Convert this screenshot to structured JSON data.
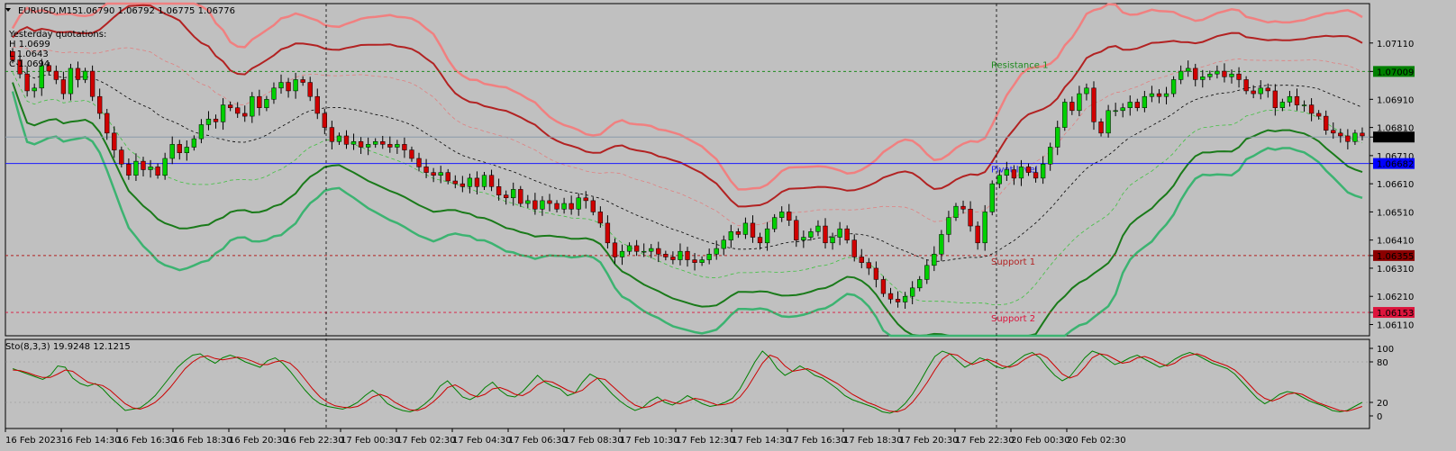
{
  "chart_data": [
    {
      "type": "candlestick",
      "symbol_header": "EURUSD,M15",
      "ohlc_header": "1.06790 1.06792 1.06775 1.06776",
      "yesterday": {
        "title": "Yesterday quotations:",
        "h": "H 1.0699",
        "l": "L 1.0643",
        "c": "C 1.0694"
      },
      "ylim": [
        1.0607,
        1.0725
      ],
      "y_ticks": [
        "1.07110",
        "1.07009",
        "1.06910",
        "1.06810",
        "1.06776",
        "1.06710",
        "1.06682",
        "1.06610",
        "1.06510",
        "1.06410",
        "1.06355",
        "1.06310",
        "1.06210",
        "1.06153",
        "1.06110"
      ],
      "highlighted_ticks": [
        {
          "value": "1.07009",
          "bg": "#008000"
        },
        {
          "value": "1.06776",
          "bg": "#000000"
        },
        {
          "value": "1.06682",
          "bg": "#0000ff"
        },
        {
          "value": "1.06355",
          "bg": "#8b0000"
        },
        {
          "value": "1.06153",
          "bg": "#dc143c"
        }
      ],
      "levels": [
        {
          "label": "Resistance 1",
          "value": 1.07009,
          "color": "#1e8a1e",
          "style": "dotted"
        },
        {
          "label": "Pivot level",
          "value": 1.06682,
          "color": "#1a1aff",
          "style": "solid"
        },
        {
          "label": "Support 1",
          "value": 1.06355,
          "color": "#b22222",
          "style": "dotted"
        },
        {
          "label": "Support 2",
          "value": 1.06153,
          "color": "#dc143c",
          "style": "dotted"
        },
        {
          "label": "",
          "value": 1.06776,
          "color": "#8a9aaa",
          "style": "solid"
        }
      ],
      "close": [
        1.0705,
        1.07,
        1.0694,
        1.0695,
        1.0703,
        1.0701,
        1.0698,
        1.0693,
        1.0702,
        1.0698,
        1.0701,
        1.0692,
        1.0686,
        1.0679,
        1.0673,
        1.0668,
        1.0664,
        1.0669,
        1.0666,
        1.0667,
        1.0664,
        1.067,
        1.0675,
        1.0672,
        1.0674,
        1.0677,
        1.0682,
        1.0684,
        1.0683,
        1.0689,
        1.0688,
        1.0686,
        1.0685,
        1.0692,
        1.0688,
        1.0691,
        1.0695,
        1.0697,
        1.0694,
        1.0698,
        1.0697,
        1.0692,
        1.0686,
        1.0681,
        1.0676,
        1.0678,
        1.0675,
        1.0676,
        1.0674,
        1.0675,
        1.0676,
        1.0675,
        1.0674,
        1.0675,
        1.0673,
        1.067,
        1.0667,
        1.0665,
        1.0664,
        1.0665,
        1.0662,
        1.0661,
        1.066,
        1.0663,
        1.066,
        1.0664,
        1.066,
        1.0657,
        1.0656,
        1.0659,
        1.0654,
        1.0655,
        1.0652,
        1.0655,
        1.0654,
        1.0652,
        1.0654,
        1.0652,
        1.0656,
        1.0655,
        1.0651,
        1.0647,
        1.064,
        1.0635,
        1.0637,
        1.0639,
        1.0637,
        1.0637,
        1.0638,
        1.0636,
        1.0635,
        1.0634,
        1.0637,
        1.0634,
        1.0633,
        1.0634,
        1.0636,
        1.0638,
        1.0641,
        1.0644,
        1.0643,
        1.0647,
        1.0642,
        1.064,
        1.0645,
        1.0649,
        1.0651,
        1.0648,
        1.0641,
        1.0642,
        1.0644,
        1.0646,
        1.064,
        1.0642,
        1.0645,
        1.0641,
        1.0635,
        1.0633,
        1.0631,
        1.0627,
        1.0622,
        1.062,
        1.0619,
        1.0621,
        1.0624,
        1.0627,
        1.0632,
        1.0636,
        1.0643,
        1.0649,
        1.0653,
        1.0652,
        1.0646,
        1.064,
        1.0651,
        1.0661,
        1.0664,
        1.0666,
        1.0663,
        1.0667,
        1.0665,
        1.0663,
        1.0668,
        1.0674,
        1.0681,
        1.069,
        1.0687,
        1.0693,
        1.0695,
        1.0683,
        1.0679,
        1.0687,
        1.0687,
        1.0688,
        1.069,
        1.0688,
        1.0692,
        1.0693,
        1.0692,
        1.0693,
        1.0698,
        1.0701,
        1.0702,
        1.0698,
        1.0699,
        1.07,
        1.0701,
        1.0699,
        1.07,
        1.0698,
        1.0694,
        1.0693,
        1.0695,
        1.0694,
        1.0688,
        1.069,
        1.0692,
        1.0689,
        1.0689,
        1.0686,
        1.0685,
        1.068,
        1.0679,
        1.0678,
        1.0676,
        1.0679,
        1.0678
      ]
    },
    {
      "type": "line",
      "title": "Sto(8,3,3) 19.9248 12.1215",
      "ylim": [
        0,
        100
      ],
      "y_ticks": [
        "100",
        "80",
        "20",
        "0"
      ],
      "series": [
        {
          "color": "#008000",
          "values": [
            70,
            66,
            62,
            58,
            54,
            60,
            74,
            72,
            56,
            48,
            44,
            48,
            40,
            28,
            18,
            8,
            10,
            12,
            20,
            30,
            44,
            58,
            72,
            82,
            90,
            92,
            84,
            78,
            86,
            90,
            86,
            80,
            76,
            72,
            82,
            86,
            78,
            66,
            52,
            38,
            26,
            18,
            14,
            12,
            10,
            14,
            20,
            30,
            38,
            30,
            18,
            12,
            8,
            6,
            10,
            18,
            28,
            44,
            52,
            40,
            28,
            24,
            30,
            42,
            50,
            38,
            30,
            28,
            36,
            48,
            60,
            50,
            44,
            40,
            30,
            34,
            50,
            62,
            56,
            44,
            32,
            22,
            14,
            8,
            12,
            22,
            28,
            20,
            16,
            22,
            30,
            24,
            18,
            14,
            16,
            20,
            26,
            40,
            60,
            80,
            96,
            86,
            70,
            60,
            66,
            74,
            68,
            60,
            56,
            48,
            40,
            30,
            24,
            20,
            16,
            12,
            6,
            4,
            8,
            18,
            32,
            50,
            70,
            88,
            96,
            92,
            82,
            72,
            78,
            86,
            82,
            74,
            70,
            74,
            82,
            90,
            94,
            86,
            72,
            60,
            52,
            58,
            72,
            86,
            96,
            92,
            84,
            76,
            80,
            86,
            90,
            84,
            78,
            72,
            76,
            84,
            90,
            94,
            90,
            84,
            78,
            74,
            70,
            62,
            50,
            38,
            26,
            18,
            24,
            32,
            36,
            34,
            28,
            22,
            18,
            14,
            8,
            6,
            8,
            14,
            20
          ]
        },
        {
          "color": "#cc0000",
          "values": [
            68,
            67,
            64,
            60,
            57,
            57,
            62,
            68,
            66,
            58,
            50,
            47,
            45,
            38,
            28,
            18,
            12,
            10,
            14,
            20,
            30,
            42,
            56,
            70,
            80,
            87,
            89,
            85,
            83,
            85,
            87,
            85,
            81,
            76,
            76,
            80,
            82,
            78,
            68,
            54,
            40,
            28,
            20,
            15,
            13,
            12,
            14,
            20,
            28,
            32,
            28,
            20,
            14,
            9,
            8,
            12,
            20,
            30,
            42,
            46,
            40,
            32,
            28,
            32,
            40,
            42,
            38,
            32,
            30,
            36,
            46,
            52,
            50,
            44,
            38,
            34,
            38,
            48,
            56,
            54,
            44,
            34,
            24,
            16,
            12,
            14,
            20,
            24,
            20,
            18,
            22,
            26,
            24,
            20,
            16,
            17,
            20,
            28,
            42,
            60,
            78,
            90,
            86,
            74,
            66,
            68,
            70,
            66,
            60,
            54,
            48,
            40,
            32,
            26,
            20,
            16,
            11,
            7,
            6,
            10,
            20,
            34,
            50,
            68,
            84,
            92,
            90,
            82,
            76,
            80,
            84,
            80,
            74,
            72,
            76,
            84,
            90,
            92,
            86,
            74,
            62,
            56,
            60,
            72,
            86,
            92,
            90,
            84,
            78,
            80,
            86,
            88,
            84,
            78,
            74,
            78,
            86,
            90,
            92,
            88,
            82,
            78,
            74,
            68,
            58,
            46,
            34,
            26,
            22,
            26,
            32,
            34,
            32,
            26,
            20,
            16,
            12,
            8,
            7,
            10,
            14
          ]
        }
      ]
    }
  ],
  "x_labels": [
    "16 Feb 2023",
    "16 Feb 14:30",
    "16 Feb 16:30",
    "16 Feb 18:30",
    "16 Feb 20:30",
    "16 Feb 22:30",
    "17 Feb 00:30",
    "17 Feb 02:30",
    "17 Feb 04:30",
    "17 Feb 06:30",
    "17 Feb 08:30",
    "17 Feb 10:30",
    "17 Feb 12:30",
    "17 Feb 14:30",
    "17 Feb 16:30",
    "17 Feb 18:30",
    "17 Feb 20:30",
    "17 Feb 22:30",
    "20 Feb 00:30",
    "20 Feb 02:30"
  ],
  "colors": {
    "background": "#c0c0c0",
    "bull": "#00d000",
    "bear": "#d00000",
    "wick": "#000000"
  }
}
